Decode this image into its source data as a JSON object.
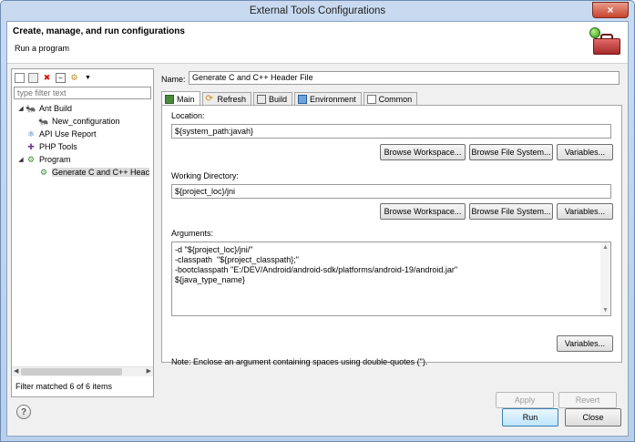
{
  "window": {
    "title": "External Tools Configurations"
  },
  "header": {
    "title": "Create, manage, and run configurations",
    "subtitle": "Run a program"
  },
  "left": {
    "filter_placeholder": "type filter text",
    "tree": [
      {
        "label": "Ant Build",
        "level": 0,
        "expanded": true,
        "icon": "ant-icon"
      },
      {
        "label": "New_configuration",
        "level": 1,
        "icon": "ant-config-icon"
      },
      {
        "label": "API Use Report",
        "level": 0,
        "icon": "report-icon"
      },
      {
        "label": "PHP Tools",
        "level": 0,
        "icon": "php-icon"
      },
      {
        "label": "Program",
        "level": 0,
        "expanded": true,
        "icon": "program-icon"
      },
      {
        "label": "Generate C and C++ Heac",
        "level": 1,
        "selected": true,
        "icon": "program-config-icon"
      }
    ],
    "status": "Filter matched 6 of 6 items"
  },
  "right": {
    "name_label": "Name:",
    "name_value": "Generate C and C++ Header File",
    "tabs": [
      {
        "label": "Main",
        "active": true
      },
      {
        "label": "Refresh"
      },
      {
        "label": "Build"
      },
      {
        "label": "Environment"
      },
      {
        "label": "Common"
      }
    ],
    "location": {
      "label": "Location:",
      "value": "${system_path:javah}",
      "buttons": [
        "Browse Workspace...",
        "Browse File System...",
        "Variables..."
      ]
    },
    "working_dir": {
      "label": "Working Directory:",
      "value": "${project_loc}/jni",
      "buttons": [
        "Browse Workspace...",
        "Browse File System...",
        "Variables..."
      ]
    },
    "arguments": {
      "label": "Arguments:",
      "value": "-d \"${project_loc}/jni/\"\n-classpath  \"${project_classpath};\"\n-bootclasspath \"E:/DEV/Android/android-sdk/platforms/android-19/android.jar\"\n${java_type_name}",
      "button": "Variables..."
    },
    "note": "Note: Enclose an argument containing spaces using double-quotes (\").",
    "apply": "Apply",
    "revert": "Revert"
  },
  "footer": {
    "run": "Run",
    "close": "Close",
    "help": "?"
  }
}
